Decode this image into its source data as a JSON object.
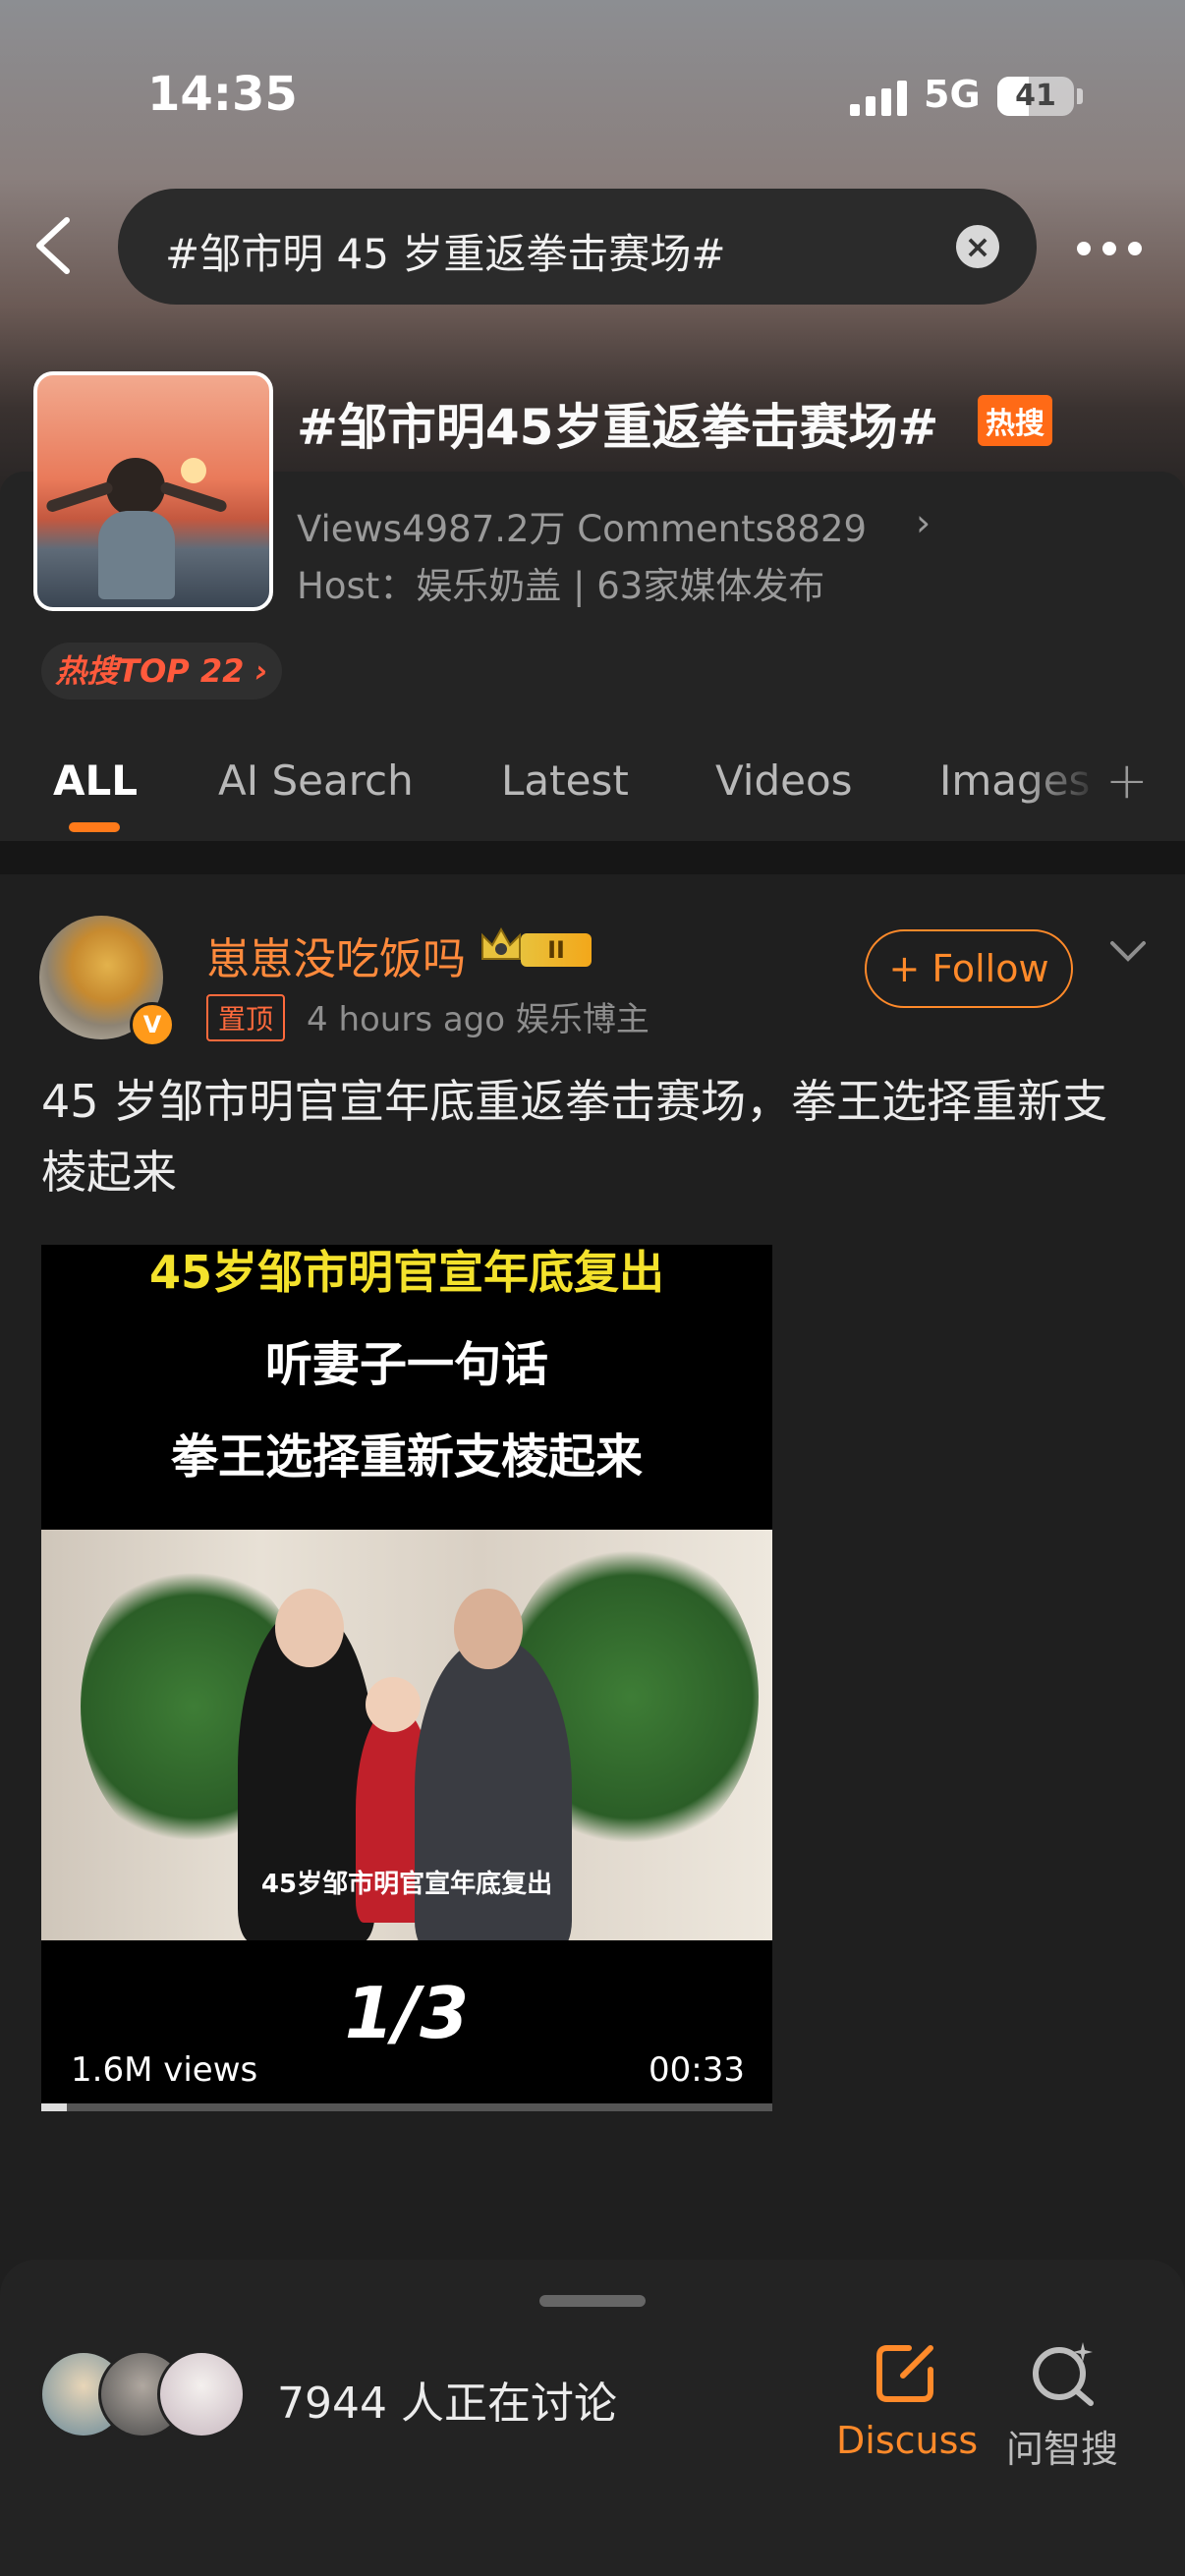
{
  "status_bar": {
    "time": "14:35",
    "network": "5G",
    "battery": "41"
  },
  "search": {
    "query": "#邹市明 45 岁重返拳击赛场#"
  },
  "topic": {
    "title": "#邹市明45岁重返拳击赛场#",
    "hot_badge": "热搜",
    "stats": "Views4987.2万  Comments8829",
    "host": "Host：娱乐奶盖 | 63家媒体发布",
    "rank": "热搜TOP 22 ›"
  },
  "tabs": [
    {
      "label": "ALL",
      "active": true
    },
    {
      "label": "AI Search"
    },
    {
      "label": "Latest"
    },
    {
      "label": "Videos"
    },
    {
      "label": "Images"
    }
  ],
  "post": {
    "author": "崽崽没吃饭吗",
    "level": "II",
    "pin": "置顶",
    "meta": "4 hours ago  娱乐博主",
    "follow": "+ Follow",
    "text": "45 岁邹市明官宣年底重返拳击赛场，拳王选择重新支棱起来",
    "video": {
      "caption1": "45岁邹市明官宣年底复出",
      "caption2": "听妻子一句话",
      "caption3": "拳王选择重新支棱起来",
      "photo_caption": "45岁邹市明官宣年底复出",
      "page": "1/3",
      "views": "1.6M views",
      "duration": "00:33",
      "progress": 0.035
    }
  },
  "bottom": {
    "discussing": "7944 人正在讨论",
    "discuss_label": "Discuss",
    "ask_label": "问智搜"
  },
  "colors": {
    "accent": "#ff8a2a",
    "hot": "#ff6a16",
    "background": "#1f1f1f"
  }
}
